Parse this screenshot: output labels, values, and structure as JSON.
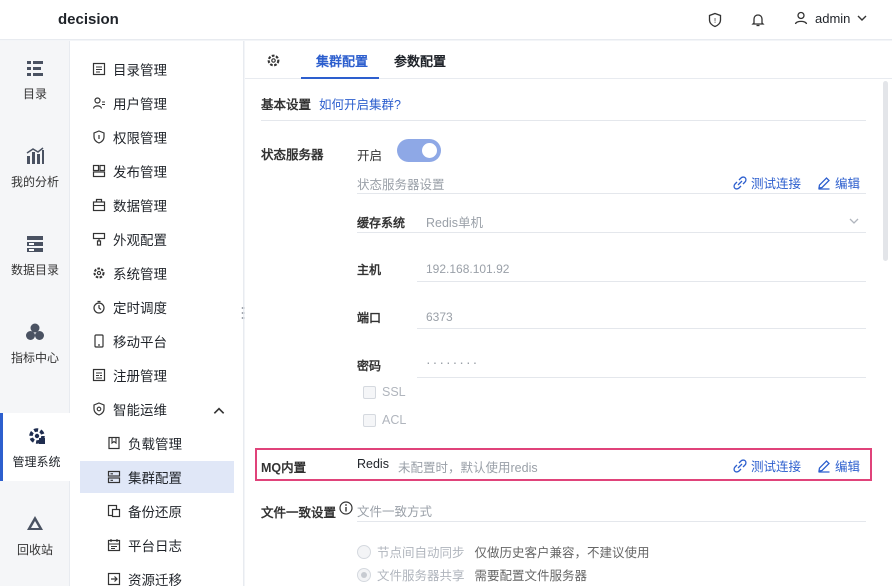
{
  "header": {
    "brand": "decision",
    "user": "admin"
  },
  "rail": [
    {
      "label": "目录",
      "icon": "list-icon"
    },
    {
      "label": "我的分析",
      "icon": "chart-icon"
    },
    {
      "label": "数据目录",
      "icon": "database-icon"
    },
    {
      "label": "指标中心",
      "icon": "cubes-icon"
    },
    {
      "label": "管理系统",
      "icon": "gear-icon"
    },
    {
      "label": "回收站",
      "icon": "recycle-icon"
    }
  ],
  "menu": {
    "items": [
      "目录管理",
      "用户管理",
      "权限管理",
      "发布管理",
      "数据管理",
      "外观配置",
      "系统管理",
      "定时调度",
      "移动平台",
      "注册管理",
      "智能运维"
    ],
    "sub": [
      "负载管理",
      "集群配置",
      "备份还原",
      "平台日志",
      "资源迁移"
    ]
  },
  "tabs": {
    "cluster": "集群配置",
    "params": "参数配置"
  },
  "basic": {
    "title": "基本设置",
    "help": "如何开启集群?"
  },
  "state": {
    "label": "状态服务器",
    "toggle_label": "开启",
    "hint": "状态服务器设置",
    "test": "测试连接",
    "edit": "编辑",
    "cache_label": "缓存系统",
    "cache_value": "Redis单机",
    "host_label": "主机",
    "host_value": "192.168.101.92",
    "port_label": "端口",
    "port_value": "6373",
    "pwd_label": "密码",
    "pwd_value": "········",
    "ssl": "SSL",
    "acl": "ACL"
  },
  "mq": {
    "label": "MQ内置",
    "value": "Redis",
    "hint": "未配置时，默认使用redis",
    "test": "测试连接",
    "edit": "编辑"
  },
  "file": {
    "label": "文件一致设置",
    "hint": "文件一致方式",
    "opt1": "节点间自动同步",
    "opt1_note": "仅做历史客户兼容，不建议使用",
    "opt2": "文件服务器共享",
    "opt2_note": "需要配置文件服务器"
  }
}
